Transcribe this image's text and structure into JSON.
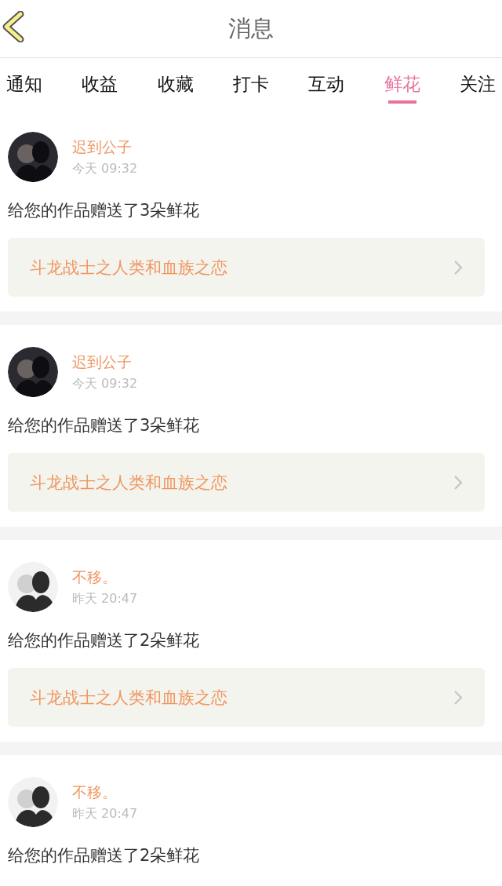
{
  "header": {
    "title": "消息"
  },
  "tabs": [
    {
      "label": "通知",
      "selected": false
    },
    {
      "label": "收益",
      "selected": false
    },
    {
      "label": "收藏",
      "selected": false
    },
    {
      "label": "打卡",
      "selected": false
    },
    {
      "label": "互动",
      "selected": false
    },
    {
      "label": "鲜花",
      "selected": true
    },
    {
      "label": "关注",
      "selected": false
    }
  ],
  "messages": [
    {
      "name": "迟到公子",
      "time": "今天 09:32",
      "text": "给您的作品赠送了3朵鲜花",
      "work": "斗龙战士之人类和血族之恋"
    },
    {
      "name": "迟到公子",
      "time": "今天 09:32",
      "text": "给您的作品赠送了3朵鲜花",
      "work": "斗龙战士之人类和血族之恋"
    },
    {
      "name": "不移。",
      "time": "昨天 20:47",
      "text": "给您的作品赠送了2朵鲜花",
      "work": "斗龙战士之人类和血族之恋"
    },
    {
      "name": "不移。",
      "time": "昨天 20:47",
      "text": "给您的作品赠送了2朵鲜花"
    }
  ]
}
